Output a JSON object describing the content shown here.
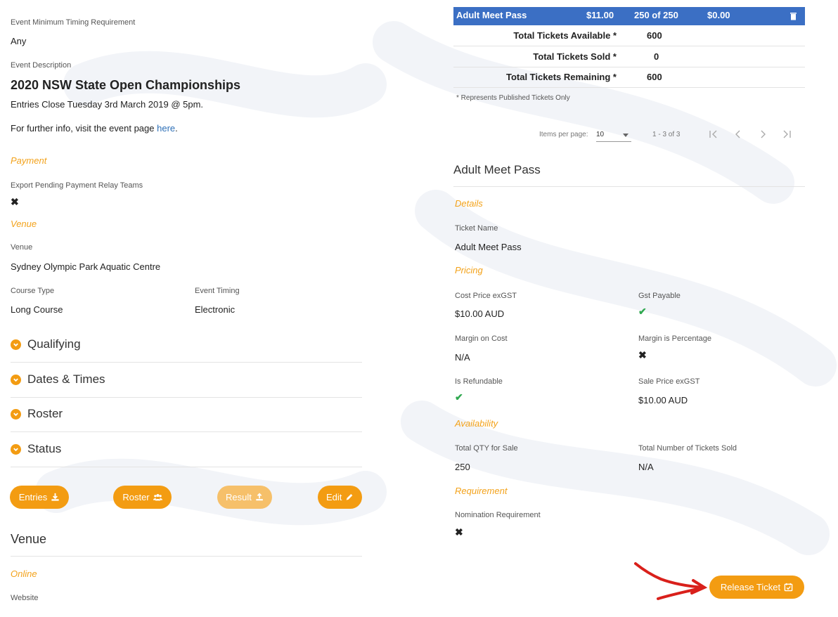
{
  "left": {
    "min_timing_label": "Event Minimum Timing Requirement",
    "min_timing_value": "Any",
    "desc_label": "Event Description",
    "desc_title": "2020 NSW State Open Championships",
    "desc_line1": "Entries Close Tuesday 3rd March 2019 @ 5pm.",
    "desc_line2_prefix": "For further info, visit the event page ",
    "desc_link": "here",
    "desc_line2_suffix": ".",
    "payment_section": "Payment",
    "export_pending_label": "Export Pending Payment Relay Teams",
    "venue_section": "Venue",
    "venue_label": "Venue",
    "venue_value": "Sydney Olympic Park Aquatic Centre",
    "course_type_label": "Course Type",
    "course_type_value": "Long Course",
    "event_timing_label": "Event Timing",
    "event_timing_value": "Electronic",
    "accordions": [
      "Qualifying",
      "Dates & Times",
      "Roster",
      "Status"
    ],
    "buttons": {
      "entries": "Entries",
      "roster": "Roster",
      "result": "Result",
      "edit": "Edit"
    },
    "venue_heading": "Venue",
    "online_section": "Online",
    "website_label": "Website"
  },
  "right": {
    "top_row": {
      "name": "Adult Meet Pass",
      "price": "$11.00",
      "qty": "250 of 250",
      "amount": "$0.00"
    },
    "totals": [
      {
        "label": "Total Tickets Available *",
        "value": "600"
      },
      {
        "label": "Total Tickets Sold *",
        "value": "0"
      },
      {
        "label": "Total Tickets Remaining *",
        "value": "600"
      }
    ],
    "published_note": "* Represents Published Tickets Only",
    "pager": {
      "items_per_page_label": "Items per page:",
      "items_per_page_value": "10",
      "range": "1 - 3 of 3"
    },
    "ticket_heading": "Adult Meet Pass",
    "details_section": "Details",
    "ticket_name_label": "Ticket Name",
    "ticket_name_value": "Adult Meet Pass",
    "pricing_section": "Pricing",
    "cost_price_label": "Cost Price exGST",
    "cost_price_value": "$10.00 AUD",
    "gst_label": "Gst Payable",
    "margin_cost_label": "Margin on Cost",
    "margin_cost_value": "N/A",
    "margin_pct_label": "Margin is Percentage",
    "refundable_label": "Is Refundable",
    "sale_price_label": "Sale Price exGST",
    "sale_price_value": "$10.00 AUD",
    "availability_section": "Availability",
    "total_qty_label": "Total QTY for Sale",
    "total_qty_value": "250",
    "tickets_sold_label": "Total Number of Tickets Sold",
    "tickets_sold_value": "N/A",
    "requirement_section": "Requirement",
    "nomination_label": "Nomination Requirement",
    "release_button": "Release Ticket"
  },
  "colors": {
    "accent": "#f39c12",
    "section": "#f3a21a",
    "selected_row": "#3b6fc4",
    "check": "#2fa84f",
    "annotation_arrow": "#d9201b"
  }
}
